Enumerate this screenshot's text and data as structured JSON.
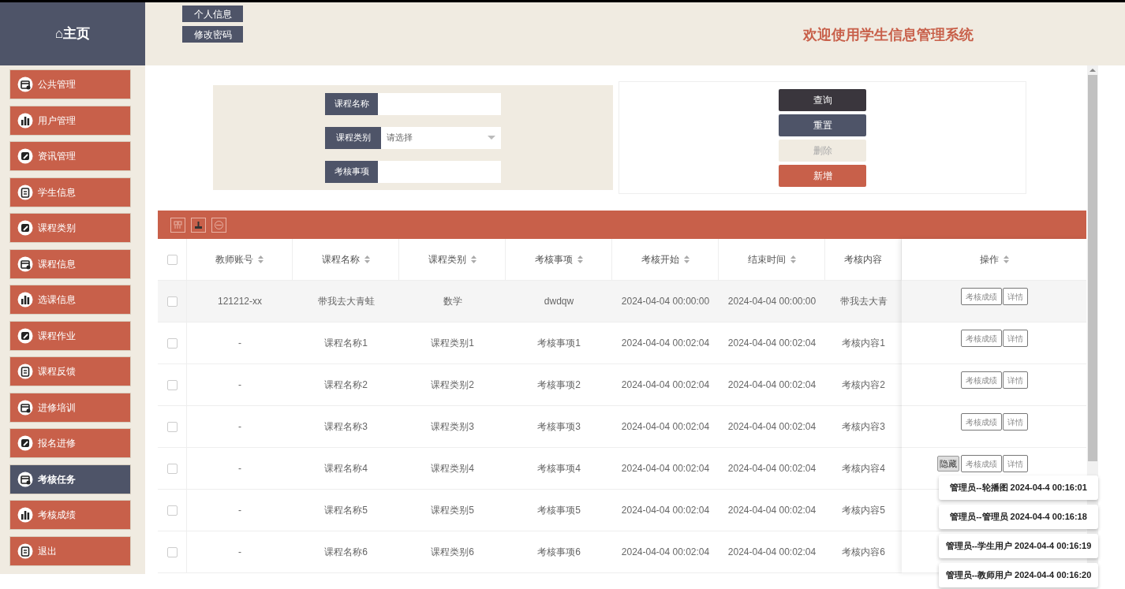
{
  "sidebar": {
    "home": "⌂主页",
    "items": [
      {
        "label": "公共管理",
        "kind": "calendar",
        "selected": false
      },
      {
        "label": "用户管理",
        "kind": "chart",
        "selected": false
      },
      {
        "label": "资讯管理",
        "kind": "edit",
        "selected": false
      },
      {
        "label": "学生信息",
        "kind": "clipboard",
        "selected": false
      },
      {
        "label": "课程类别",
        "kind": "edit",
        "selected": false
      },
      {
        "label": "课程信息",
        "kind": "calendar",
        "selected": false
      },
      {
        "label": "选课信息",
        "kind": "chart",
        "selected": false
      },
      {
        "label": "课程作业",
        "kind": "edit",
        "selected": false
      },
      {
        "label": "课程反馈",
        "kind": "clipboard",
        "selected": false
      },
      {
        "label": "进修培训",
        "kind": "calendar",
        "selected": false
      },
      {
        "label": "报名进修",
        "kind": "edit",
        "selected": false
      },
      {
        "label": "考核任务",
        "kind": "calendar",
        "selected": true
      },
      {
        "label": "考核成绩",
        "kind": "chart",
        "selected": false
      },
      {
        "label": "退出",
        "kind": "clipboard",
        "selected": false
      }
    ]
  },
  "header": {
    "buttons": [
      "个人信息",
      "修改密码"
    ],
    "title": "欢迎使用学生信息管理系统"
  },
  "search": {
    "fields": [
      {
        "label": "课程名称",
        "kind": "text"
      },
      {
        "label": "课程类别",
        "kind": "select",
        "placeholder": "请选择"
      },
      {
        "label": "考核事项",
        "kind": "text"
      }
    ],
    "buttons": [
      {
        "label": "查询",
        "kind": "query",
        "disabled": false
      },
      {
        "label": "重置",
        "kind": "reset",
        "disabled": false
      },
      {
        "label": "删除",
        "kind": "delete",
        "disabled": true
      },
      {
        "label": "新增",
        "kind": "add",
        "disabled": false
      }
    ]
  },
  "table": {
    "all_checked": false,
    "columns": [
      "教师账号",
      "课程名称",
      "课程类别",
      "考核事项",
      "考核开始",
      "结束时间",
      "考核内容",
      "操作"
    ],
    "rows": [
      {
        "cells": [
          "121212-xx",
          "带我去大青蛙",
          "数学",
          "dwdqw",
          "2024-04-04 00:00:00",
          "2024-04-04 00:00:00",
          "带我去大青"
        ],
        "checked": false,
        "actions": [
          "考核成绩",
          "详情"
        ]
      },
      {
        "cells": [
          "-",
          "课程名称1",
          "课程类别1",
          "考核事项1",
          "2024-04-04 00:02:04",
          "2024-04-04 00:02:04",
          "考核内容1"
        ],
        "checked": false,
        "actions": [
          "考核成绩",
          "详情"
        ]
      },
      {
        "cells": [
          "-",
          "课程名称2",
          "课程类别2",
          "考核事项2",
          "2024-04-04 00:02:04",
          "2024-04-04 00:02:04",
          "考核内容2"
        ],
        "checked": false,
        "actions": [
          "考核成绩",
          "详情"
        ]
      },
      {
        "cells": [
          "-",
          "课程名称3",
          "课程类别3",
          "考核事项3",
          "2024-04-04 00:02:04",
          "2024-04-04 00:02:04",
          "考核内容3"
        ],
        "checked": false,
        "actions": [
          "考核成绩",
          "详情"
        ]
      },
      {
        "cells": [
          "-",
          "课程名称4",
          "课程类别4",
          "考核事项4",
          "2024-04-04 00:02:04",
          "2024-04-04 00:02:04",
          "考核内容4"
        ],
        "checked": false,
        "actions": [
          "考核成绩",
          "详情"
        ]
      },
      {
        "cells": [
          "-",
          "课程名称5",
          "课程类别5",
          "考核事项5",
          "2024-04-04 00:02:04",
          "2024-04-04 00:02:04",
          "考核内容5"
        ],
        "checked": false
      },
      {
        "cells": [
          "-",
          "课程名称6",
          "课程类别6",
          "考核事项6",
          "2024-04-04 00:02:04",
          "2024-04-04 00:02:04",
          "考核内容6"
        ],
        "checked": false
      }
    ]
  },
  "notifications": {
    "hide_button": "隐藏",
    "items": [
      "管理员--轮播图 2024-04-4 00:16:01",
      "管理员--管理员 2024-04-4 00:16:18",
      "管理员--学生用户 2024-04-4 00:16:19",
      "管理员--教师用户 2024-04-4 00:16:20"
    ]
  }
}
